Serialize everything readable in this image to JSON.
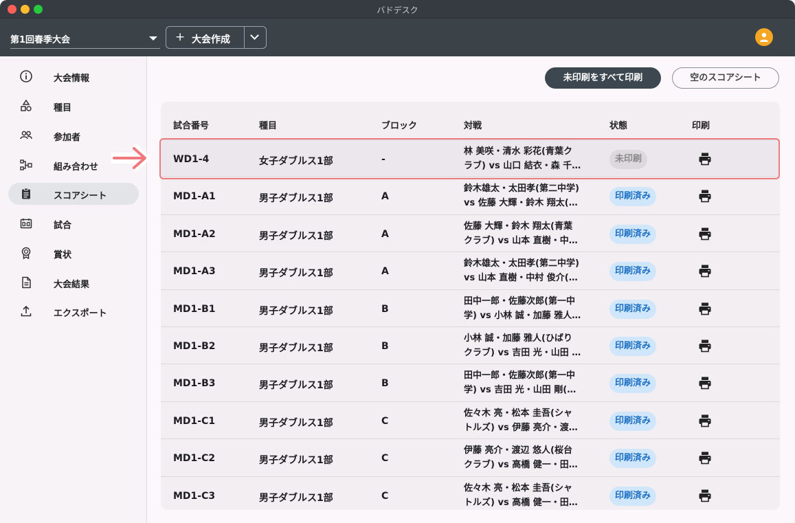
{
  "app": {
    "title": "バドデスク"
  },
  "toolbar": {
    "tournament": "第1回春季大会",
    "create_label": "大会作成"
  },
  "sidebar": {
    "items": [
      {
        "label": "大会情報",
        "icon": "info-icon",
        "active": false
      },
      {
        "label": "種目",
        "icon": "shapes-icon",
        "active": false
      },
      {
        "label": "参加者",
        "icon": "people-icon",
        "active": false
      },
      {
        "label": "組み合わせ",
        "icon": "bracket-icon",
        "active": false
      },
      {
        "label": "スコアシート",
        "icon": "clipboard-icon",
        "active": true
      },
      {
        "label": "試合",
        "icon": "scoreboard-icon",
        "active": false
      },
      {
        "label": "賞状",
        "icon": "award-icon",
        "active": false
      },
      {
        "label": "大会結果",
        "icon": "document-icon",
        "active": false
      },
      {
        "label": "エクスポート",
        "icon": "upload-icon",
        "active": false
      }
    ]
  },
  "actions": {
    "print_all_unprinted": "未印刷をすべて印刷",
    "empty_score_sheet": "空のスコアシート"
  },
  "table": {
    "headers": {
      "id": "試合番号",
      "event": "種目",
      "block": "ブロック",
      "match": "対戦",
      "status": "状態",
      "print": "印刷"
    },
    "rows": [
      {
        "id": "WD1-4",
        "event": "女子ダブルス1部",
        "block": "-",
        "match1": "林 美咲・清水 彩花(青葉ク",
        "match2": "ラブ) vs 山口 結衣・森 千…",
        "status": "未印刷",
        "printed": false,
        "highlighted": true
      },
      {
        "id": "MD1-A1",
        "event": "男子ダブルス1部",
        "block": "A",
        "match1": "鈴木雄太・太田孝(第二中学)",
        "match2": "vs 佐藤 大輝・鈴木 翔太(…",
        "status": "印刷済み",
        "printed": true
      },
      {
        "id": "MD1-A2",
        "event": "男子ダブルス1部",
        "block": "A",
        "match1": "佐藤 大輝・鈴木 翔太(青葉",
        "match2": "クラブ) vs 山本 直樹・中…",
        "status": "印刷済み",
        "printed": true
      },
      {
        "id": "MD1-A3",
        "event": "男子ダブルス1部",
        "block": "A",
        "match1": "鈴木雄太・太田孝(第二中学)",
        "match2": "vs 山本 直樹・中村 俊介(…",
        "status": "印刷済み",
        "printed": true
      },
      {
        "id": "MD1-B1",
        "event": "男子ダブルス1部",
        "block": "B",
        "match1": "田中一郎・佐藤次郎(第一中",
        "match2": "学) vs 小林 誠・加藤 雅人…",
        "status": "印刷済み",
        "printed": true
      },
      {
        "id": "MD1-B2",
        "event": "男子ダブルス1部",
        "block": "B",
        "match1": "小林 誠・加藤 雅人(ひばり",
        "match2": "クラブ) vs 吉田 光・山田 …",
        "status": "印刷済み",
        "printed": true
      },
      {
        "id": "MD1-B3",
        "event": "男子ダブルス1部",
        "block": "B",
        "match1": "田中一郎・佐藤次郎(第一中",
        "match2": "学) vs 吉田 光・山田 剛(…",
        "status": "印刷済み",
        "printed": true
      },
      {
        "id": "MD1-C1",
        "event": "男子ダブルス1部",
        "block": "C",
        "match1": "佐々木 亮・松本 圭吾(シャ",
        "match2": "トルズ) vs 伊藤 亮介・渡…",
        "status": "印刷済み",
        "printed": true
      },
      {
        "id": "MD1-C2",
        "event": "男子ダブルス1部",
        "block": "C",
        "match1": "伊藤 亮介・渡辺 悠人(桜台",
        "match2": "クラブ) vs 高橋 健一・田…",
        "status": "印刷済み",
        "printed": true
      },
      {
        "id": "MD1-C3",
        "event": "男子ダブルス1部",
        "block": "C",
        "match1": "佐々木 亮・松本 圭吾(シャ",
        "match2": "トルズ) vs 高橋 健一・田…",
        "status": "印刷済み",
        "printed": true
      }
    ]
  },
  "colors": {
    "toolbar_bg": "#3b4248",
    "accent_dark": "#3d474f",
    "printed_badge_bg": "#cfe6fb",
    "printed_badge_text": "#1d6fc2",
    "highlight": "#ef7a7d",
    "avatar": "#f5a623"
  }
}
